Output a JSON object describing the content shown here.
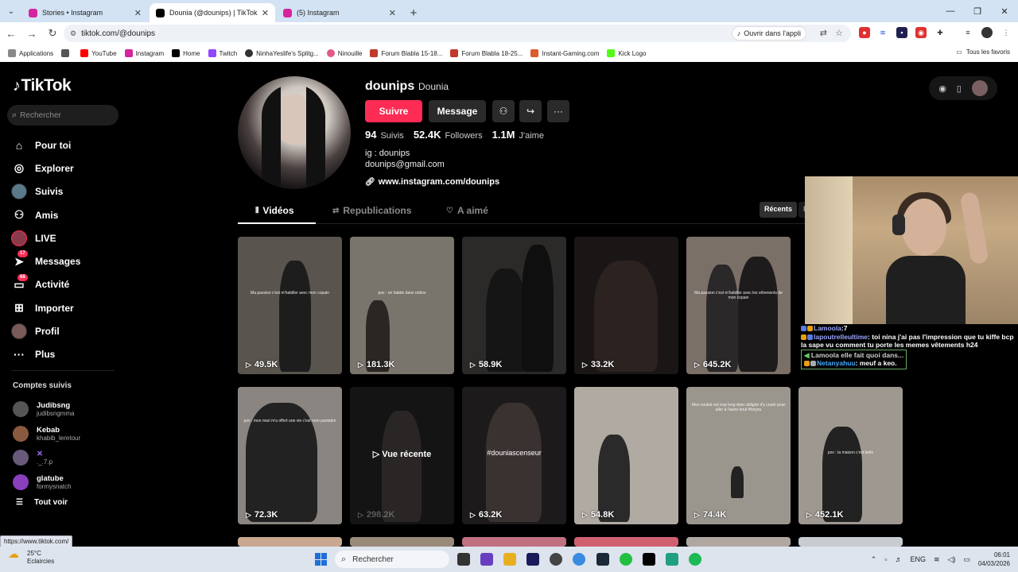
{
  "browser": {
    "tabs": [
      {
        "title": "Stories • Instagram",
        "color": "#d6249f"
      },
      {
        "title": "Dounia (@dounips) | TikTok",
        "color": "#000000"
      },
      {
        "title": "(5) Instagram",
        "color": "#d6249f"
      }
    ],
    "url": "tiktok.com/@dounips",
    "open_app_label": "Ouvrir dans l'appli",
    "bookmarks": [
      {
        "label": "Applications",
        "color": "#888888"
      },
      {
        "label": "YouTube",
        "color": "#ff0000"
      },
      {
        "label": "Instagram",
        "color": "#d6249f"
      },
      {
        "label": "Home",
        "color": "#000000"
      },
      {
        "label": "Twitch",
        "color": "#9146ff"
      },
      {
        "label": "NinhaYeslife's Splitg...",
        "color": "#333333"
      },
      {
        "label": "Ninouille",
        "color": "#e05a8a"
      },
      {
        "label": "Forum Blabla 15-18...",
        "color": "#c0392b"
      },
      {
        "label": "Forum Blabla 18-25...",
        "color": "#c0392b"
      },
      {
        "label": "Instant-Gaming.com",
        "color": "#e05a2a"
      },
      {
        "label": "Kick Logo",
        "color": "#53fc18"
      }
    ],
    "bookmarks_right": "Tous les favoris",
    "status_url": "https://www.tiktok.com/"
  },
  "sidebar": {
    "logo": "TikTok",
    "search_placeholder": "Rechercher",
    "nav": [
      {
        "label": "Pour toi",
        "icon": "home-icon",
        "glyph": "⌂"
      },
      {
        "label": "Explorer",
        "icon": "compass-icon",
        "glyph": "◎"
      },
      {
        "label": "Suivis",
        "icon": "avatar",
        "glyph": ""
      },
      {
        "label": "Amis",
        "icon": "friends-icon",
        "glyph": "👥"
      },
      {
        "label": "LIVE",
        "icon": "avatar",
        "glyph": ""
      },
      {
        "label": "Messages",
        "icon": "paper-plane-icon",
        "glyph": "➤",
        "badge": "17"
      },
      {
        "label": "Activité",
        "icon": "inbox-icon",
        "glyph": "▭",
        "badge": "68"
      },
      {
        "label": "Importer",
        "icon": "plus-square-icon",
        "glyph": "⊞"
      },
      {
        "label": "Profil",
        "icon": "avatar",
        "glyph": ""
      },
      {
        "label": "Plus",
        "icon": "more-icon",
        "glyph": "···"
      }
    ],
    "following_heading": "Comptes suivis",
    "following": [
      {
        "name": "Judibsng",
        "handle": "judibsngmma",
        "color": "#555555"
      },
      {
        "name": "Kebab",
        "handle": "khabib_leretour",
        "color": "#8a5a40"
      },
      {
        "name": "",
        "handle": "._.7.p",
        "color": "#6a5a7a"
      },
      {
        "name": "glatube",
        "handle": "formysnatch",
        "color": "#8a3fbf"
      }
    ],
    "see_all": "Tout voir"
  },
  "profile": {
    "username": "dounips",
    "nickname": "Dounia",
    "follow_label": "Suivre",
    "message_label": "Message",
    "stats": [
      {
        "value": "94",
        "label": "Suivis"
      },
      {
        "value": "52.4K",
        "label": "Followers"
      },
      {
        "value": "1.1M",
        "label": "J'aime"
      }
    ],
    "bio": [
      "ig : dounips",
      "dounips@gmail.com"
    ],
    "link": "www.instagram.com/dounips",
    "tabs": [
      "Vidéos",
      "Republications",
      "A aimé"
    ],
    "sort": [
      "Récents",
      "P"
    ]
  },
  "videos": [
    {
      "views": "49.5K",
      "caption": "Ma passion c'est m'habiller avec mon copain",
      "bg": "#5a544e"
    },
    {
      "views": "181.3K",
      "caption": "pov : on habite dans roblox",
      "bg": "#7a756c"
    },
    {
      "views": "58.9K",
      "caption": "",
      "bg": "#2c2a28"
    },
    {
      "views": "33.2K",
      "caption": "",
      "bg": "#1a1616"
    },
    {
      "views": "645.2K",
      "caption": "Ma passion c'est m'habiller avec les vêtements de mon copain",
      "bg": "#7a7068"
    },
    {
      "views": "72.3K",
      "caption": "pov : mon mari m'a offert une vie c'est mon pantalon",
      "bg": "#8a8580"
    },
    {
      "views": "298.2K",
      "caption": "",
      "bg": "#141414",
      "overlay": "Vue récente"
    },
    {
      "views": "63.2K",
      "caption": "",
      "bg": "#1c1a1a",
      "overlay": "#douniascenseur"
    },
    {
      "views": "54.8K",
      "caption": "",
      "bg": "#b0aaa2"
    },
    {
      "views": "74.4K",
      "caption": "Mon couloir est trop long donc obligée d'y courir pour aller à l'autre bout #foryou",
      "bg": "#9a968e"
    },
    {
      "views": "452.1K",
      "caption": "pov : ta maison c'est belle",
      "bg": "#9e9890"
    }
  ],
  "chat": [
    {
      "user": "Lamoola",
      "text": ":7"
    },
    {
      "user": "lapoutrelleultime",
      "text": ": toi nina j'ai pas l'impression que tu kiffe bcp la sape vu comment tu porte les memes vêtements h24"
    },
    {
      "user": "",
      "text": "Lamoola elle fait quoi dans..."
    },
    {
      "user": "Netanyahuu",
      "text": ": meuf a keo."
    }
  ],
  "taskbar": {
    "temp": "25°C",
    "weather": "Eclaircies",
    "search": "Rechercher",
    "lang": "ENG",
    "time": "06:01",
    "date": "04/03/2026"
  }
}
